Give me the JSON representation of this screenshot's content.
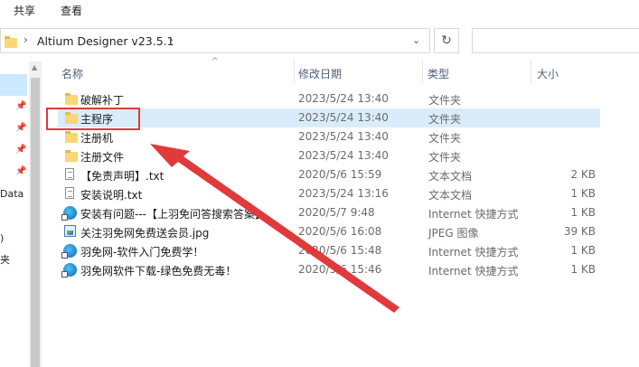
{
  "ribbon": {
    "tabs": [
      "共享",
      "查看"
    ]
  },
  "address": {
    "path": "Altium Designer v23.5.1",
    "separator": "›",
    "dropdown_glyph": "⌄",
    "refresh_glyph": "↻"
  },
  "nav": {
    "pins": [
      "📌",
      "📌",
      "📌",
      "📌"
    ],
    "texts": [
      "Data",
      ")",
      "夹"
    ]
  },
  "columns": {
    "name": "名称",
    "date": "修改日期",
    "type": "类型",
    "size": "大小"
  },
  "files": [
    {
      "name": "破解补丁",
      "date": "2023/5/24 13:40",
      "type": "文件夹",
      "size": "",
      "icon": "folder-icon"
    },
    {
      "name": "主程序",
      "date": "2023/5/24 13:40",
      "type": "文件夹",
      "size": "",
      "icon": "folder-icon"
    },
    {
      "name": "注册机",
      "date": "2023/5/24 13:40",
      "type": "文件夹",
      "size": "",
      "icon": "folder-icon"
    },
    {
      "name": "注册文件",
      "date": "2023/5/24 13:40",
      "type": "文件夹",
      "size": "",
      "icon": "folder-icon"
    },
    {
      "name": "【免责声明】.txt",
      "date": "2020/5/6 15:59",
      "type": "文本文档",
      "size": "2 KB",
      "icon": "text-file-icon"
    },
    {
      "name": "安装说明.txt",
      "date": "2023/5/24 13:16",
      "type": "文本文档",
      "size": "1 KB",
      "icon": "text-file-icon"
    },
    {
      "name": "安装有问题---【上羽免问答搜索答案】",
      "date": "2020/5/7 9:48",
      "type": "Internet 快捷方式",
      "size": "1 KB",
      "icon": "internet-shortcut-icon"
    },
    {
      "name": "关注羽免网免费送会员.jpg",
      "date": "2020/5/6 16:08",
      "type": "JPEG 图像",
      "size": "39 KB",
      "icon": "jpeg-image-icon"
    },
    {
      "name": "羽免网-软件入门免费学！",
      "date": "2020/5/6 15:48",
      "type": "Internet 快捷方式",
      "size": "1 KB",
      "icon": "internet-shortcut-icon"
    },
    {
      "name": "羽免网软件下载-绿色免费无毒！",
      "date": "2020/5/6 15:46",
      "type": "Internet 快捷方式",
      "size": "1 KB",
      "icon": "internet-shortcut-icon"
    }
  ],
  "selected_index": 1,
  "colors": {
    "annotation": "#e03a3a",
    "selection": "#d9ecfb",
    "folder": "#f8d775"
  }
}
